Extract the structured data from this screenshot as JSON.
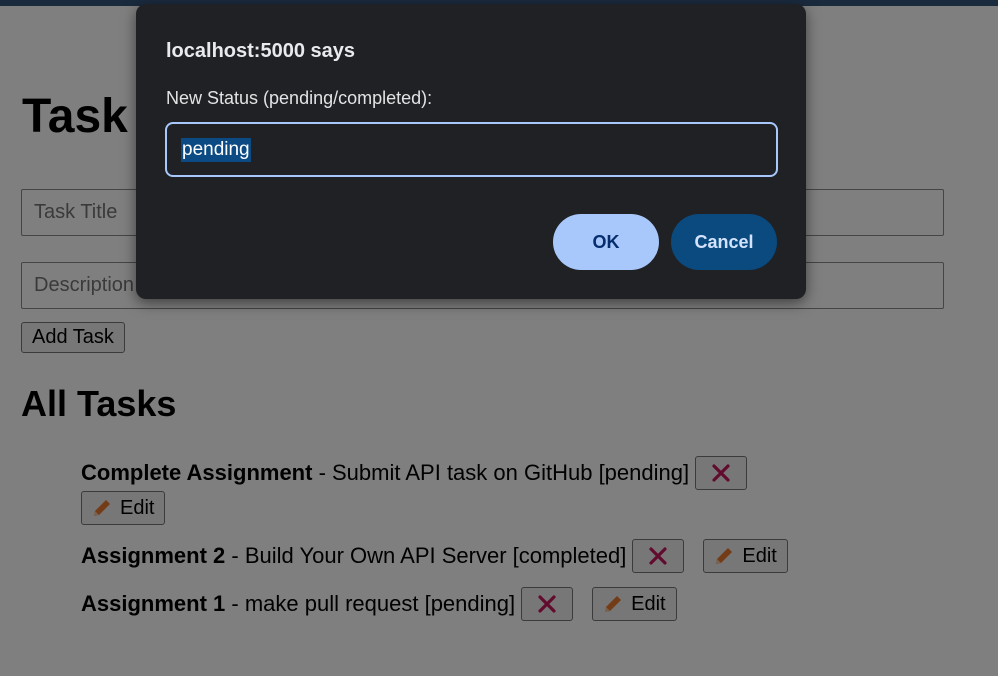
{
  "page": {
    "title": "Task",
    "inputs": {
      "title_placeholder": "Task Title",
      "description_placeholder": "Description"
    },
    "add_button": "Add Task",
    "list_heading": "All Tasks"
  },
  "tasks": [
    {
      "title": "Complete Assignment",
      "rest": " - Submit API task on GitHub [pending]",
      "edit_label": "Edit"
    },
    {
      "title": "Assignment 2",
      "rest": " - Build Your Own API Server [completed]",
      "edit_label": "Edit"
    },
    {
      "title": "Assignment 1",
      "rest": " - make pull request [pending]",
      "edit_label": "Edit"
    }
  ],
  "dialog": {
    "title": "localhost:5000 says",
    "message": "New Status (pending/completed):",
    "value": "pending",
    "ok": "OK",
    "cancel": "Cancel"
  },
  "icons": {
    "delete": "x-icon",
    "edit": "pencil-icon",
    "delete_color": "#c2185b",
    "edit_color": "#e8772e"
  }
}
